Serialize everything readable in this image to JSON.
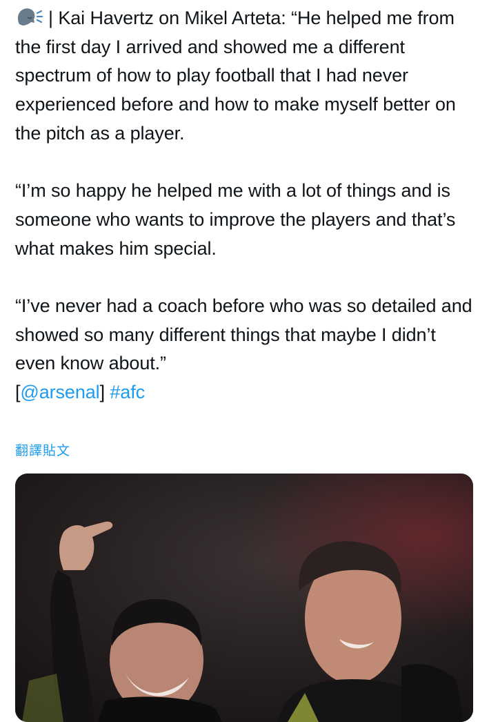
{
  "tweet": {
    "p1": {
      "icon": "speaking-head-icon",
      "lead": "| Kai Havertz on Mikel Arteta: “He helped me from the first day I arrived and showed me a different spectrum of how to play football that I had never experienced before and how to make myself better on the pitch as a player."
    },
    "p2": "“I’m so happy he helped me with a lot of things and is someone who wants to improve the players and that’s what makes him special.",
    "p3": "“I’ve never had a coach before who was so detailed and showed so many different things that maybe I didn’t even know about.”",
    "mention_open": "[",
    "mention": "@arsenal",
    "mention_close": "]",
    "hashtag": "#afc"
  },
  "translate_label": "翻譯貼文",
  "media": {
    "description_icon": "photo-of-arteta-and-havertz"
  },
  "colors": {
    "text": "#0f1419",
    "link": "#1d9bf0",
    "background": "#ffffff"
  }
}
